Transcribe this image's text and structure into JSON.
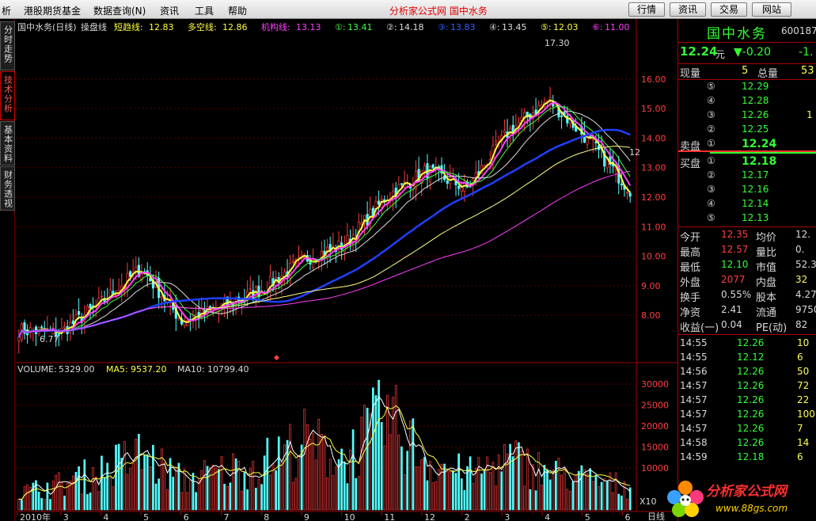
{
  "menubar": {
    "items": [
      "析",
      "港股期货基金",
      "数据查询(N)",
      "资讯",
      "工具",
      "帮助"
    ],
    "center_title": "分析家公式网  国中水务",
    "buttons": [
      "行情",
      "资讯",
      "交易",
      "网站"
    ]
  },
  "left_tabs": [
    "分时走势",
    "技术分析",
    "基本资料",
    "财务透视"
  ],
  "chart_header": {
    "name": "国中水务(日线)",
    "indicator": "操盘线",
    "items": [
      {
        "label": "短趋线:",
        "value": "12.83",
        "color": "#ffff40"
      },
      {
        "label": "多空线:",
        "value": "12.86",
        "color": "#ffff40"
      },
      {
        "label": "机构线:",
        "value": "13.13",
        "color": "#ff40ff"
      },
      {
        "label": "①:",
        "value": "13.41",
        "color": "#40ff40"
      },
      {
        "label": "②:",
        "value": "14.18",
        "color": "#dddddd"
      },
      {
        "label": "③:",
        "value": "13.83",
        "color": "#3060ff"
      },
      {
        "label": "④:",
        "value": "13.45",
        "color": "#dddddd"
      },
      {
        "label": "⑤:",
        "value": "12.03",
        "color": "#ffff40"
      },
      {
        "label": "⑥:",
        "value": "11.00",
        "color": "#ff40ff"
      }
    ]
  },
  "price_axis": {
    "ticks": [
      "16.00",
      "15.00",
      "14.00",
      "13.00",
      "12.00",
      "11.00",
      "10.00",
      "9.00",
      "8.00"
    ],
    "high_label": "17.30",
    "low_label": "6.77",
    "right_mark": "12"
  },
  "volume_header": {
    "vol_label": "VOLUME:",
    "vol": "5329.00",
    "ma5_label": "MA5:",
    "ma5": "9537.20",
    "ma10_label": "MA10:",
    "ma10": "10799.40"
  },
  "volume_axis": {
    "ticks": [
      "30000",
      "25000",
      "20000",
      "15000",
      "10000"
    ],
    "unit": "X10",
    "corner": "日线"
  },
  "date_axis": {
    "labels": [
      "2010年",
      "3",
      "4",
      "5",
      "6",
      "7",
      "8",
      "9",
      "10",
      "11",
      "12",
      "2",
      "3",
      "4",
      "5",
      "6"
    ]
  },
  "chart_data": [
    {
      "type": "candlestick",
      "title": "国中水务(日线)",
      "x": [
        "2010年",
        "3",
        "4",
        "5",
        "6",
        "7",
        "8",
        "9",
        "10",
        "11",
        "12",
        "2",
        "3",
        "4",
        "5",
        "6"
      ],
      "close_approx": [
        7.5,
        7.4,
        8.4,
        9.6,
        7.8,
        8.3,
        8.9,
        9.9,
        10.4,
        12.0,
        12.9,
        12.3,
        14.2,
        15.3,
        13.9,
        12.24
      ],
      "ylim": [
        6.5,
        17.5
      ],
      "high": 17.3,
      "low": 6.77
    },
    {
      "type": "bar",
      "title": "VOLUME",
      "ylim": [
        0,
        34000
      ],
      "x": [
        "2010年",
        "3",
        "4",
        "5",
        "6",
        "7",
        "8",
        "9",
        "10",
        "11",
        "12",
        "2",
        "3",
        "4",
        "5",
        "6"
      ],
      "values": [
        4000,
        6000,
        9000,
        13000,
        7000,
        9000,
        11000,
        16000,
        12000,
        22000,
        12000,
        8000,
        12000,
        9000,
        7000,
        5329
      ]
    }
  ],
  "quote": {
    "name": "国中水务",
    "code": "600187",
    "price": "12.24",
    "price_unit": "元",
    "change": "▼-0.20",
    "change_pct": "-1.",
    "xianliang_label": "现量",
    "xianliang": "5",
    "zongliang_label": "总量",
    "zongliang": "53",
    "sell_label": "卖盘",
    "buy_label": "买盘",
    "sell": [
      {
        "n": "⑤",
        "p": "12.29",
        "v": ""
      },
      {
        "n": "④",
        "p": "12.28",
        "v": ""
      },
      {
        "n": "③",
        "p": "12.26",
        "v": "1"
      },
      {
        "n": "②",
        "p": "12.25",
        "v": ""
      },
      {
        "n": "①",
        "p": "12.24",
        "v": ""
      }
    ],
    "buy": [
      {
        "n": "①",
        "p": "12.18",
        "v": ""
      },
      {
        "n": "②",
        "p": "12.17",
        "v": ""
      },
      {
        "n": "③",
        "p": "12.16",
        "v": ""
      },
      {
        "n": "④",
        "p": "12.14",
        "v": ""
      },
      {
        "n": "⑤",
        "p": "12.13",
        "v": ""
      }
    ],
    "stats": [
      {
        "l1": "今开",
        "v1": "12.35",
        "c1": "r",
        "l2": "均价",
        "v2": "12.",
        "c2": "w"
      },
      {
        "l1": "最高",
        "v1": "12.57",
        "c1": "r",
        "l2": "量比",
        "v2": "0.",
        "c2": "w"
      },
      {
        "l1": "最低",
        "v1": "12.10",
        "c1": "g",
        "l2": "市值",
        "v2": "52.3",
        "c2": "w"
      },
      {
        "l1": "外盘",
        "v1": "2077",
        "c1": "r",
        "l2": "内盘",
        "v2": "32",
        "c2": "y"
      },
      {
        "l1": "换手",
        "v1": "0.55%",
        "c1": "w",
        "l2": "股本",
        "v2": "4.27",
        "c2": "w"
      },
      {
        "l1": "净资",
        "v1": "2.41",
        "c1": "w",
        "l2": "流通",
        "v2": "9750",
        "c2": "w"
      },
      {
        "l1": "收益(一)",
        "v1": "0.04",
        "c1": "w",
        "l2": "PE(动)",
        "v2": "82",
        "c2": "w"
      }
    ],
    "ticks": [
      {
        "t": "14:55",
        "p": "12.26",
        "v": "10"
      },
      {
        "t": "14:55",
        "p": "12.12",
        "v": "6"
      },
      {
        "t": "14:56",
        "p": "12.26",
        "v": "50"
      },
      {
        "t": "14:57",
        "p": "12.26",
        "v": "72"
      },
      {
        "t": "14:57",
        "p": "12.26",
        "v": "22"
      },
      {
        "t": "14:57",
        "p": "12.26",
        "v": "100"
      },
      {
        "t": "14:57",
        "p": "12.26",
        "v": "7"
      },
      {
        "t": "14:58",
        "p": "12.26",
        "v": "14"
      },
      {
        "t": "14:59",
        "p": "12.18",
        "v": "6"
      }
    ]
  },
  "logo": {
    "title": "分析家公式网",
    "url": "www.88gs.com"
  }
}
